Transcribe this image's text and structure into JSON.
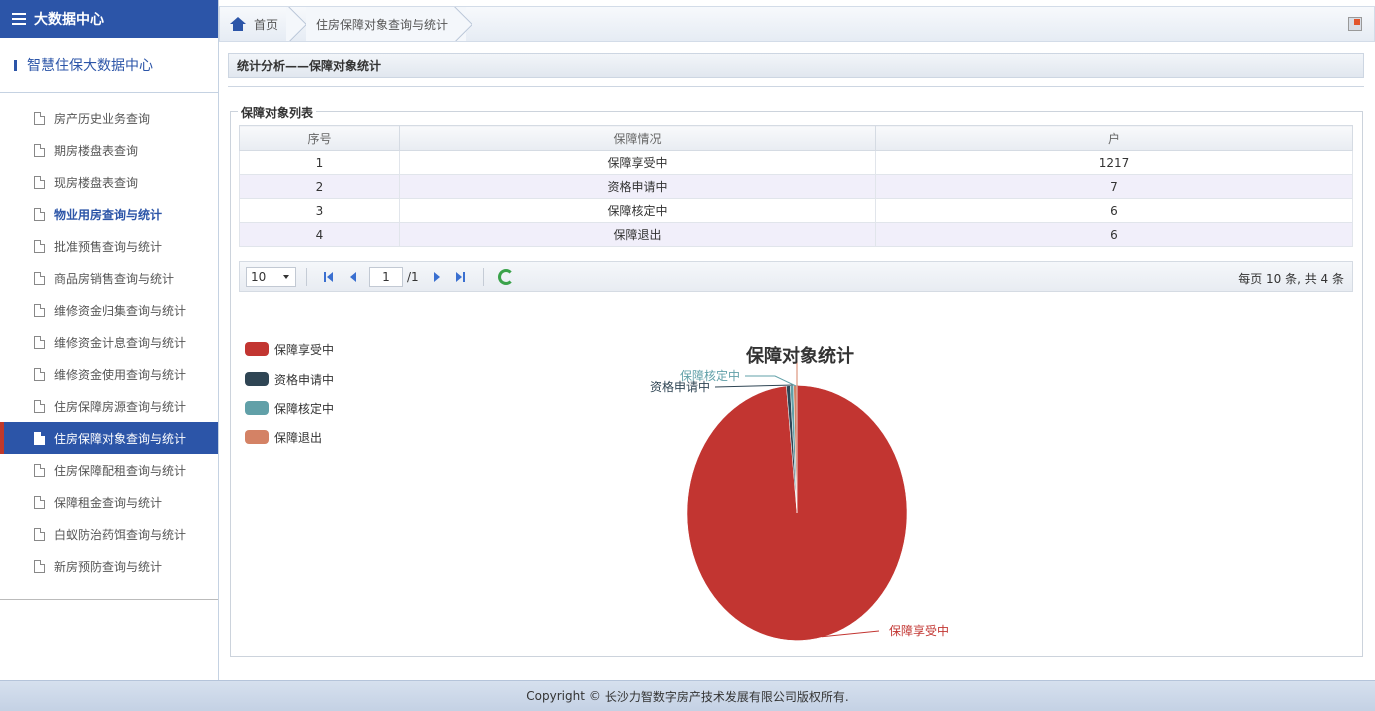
{
  "sidebar": {
    "brand": "大数据中心",
    "subheader": "智慧住保大数据中心",
    "items": [
      {
        "label": "房产历史业务查询"
      },
      {
        "label": "期房楼盘表查询"
      },
      {
        "label": "现房楼盘表查询"
      },
      {
        "label": "物业用房查询与统计"
      },
      {
        "label": "批准预售查询与统计"
      },
      {
        "label": "商品房销售查询与统计"
      },
      {
        "label": "维修资金归集查询与统计"
      },
      {
        "label": "维修资金计息查询与统计"
      },
      {
        "label": "维修资金使用查询与统计"
      },
      {
        "label": "住房保障房源查询与统计"
      },
      {
        "label": "住房保障对象查询与统计"
      },
      {
        "label": "住房保障配租查询与统计"
      },
      {
        "label": "保障租金查询与统计"
      },
      {
        "label": "白蚁防治药饵查询与统计"
      },
      {
        "label": "新房预防查询与统计"
      }
    ]
  },
  "breadcrumb": {
    "home": "首页",
    "page": "住房保障对象查询与统计"
  },
  "section": {
    "title": "统计分析——保障对象统计",
    "list_legend": "保障对象列表"
  },
  "table": {
    "headers": [
      "序号",
      "保障情况",
      "户"
    ],
    "rows": [
      [
        "1",
        "保障享受中",
        "1217"
      ],
      [
        "2",
        "资格申请中",
        "7"
      ],
      [
        "3",
        "保障核定中",
        "6"
      ],
      [
        "4",
        "保障退出",
        "6"
      ]
    ]
  },
  "pager": {
    "page_size": "10",
    "current_page": "1",
    "total_pages": "/1",
    "summary": "每页 10 条, 共 4 条"
  },
  "chart_data": {
    "type": "pie",
    "title": "保障对象统计",
    "categories": [
      "保障享受中",
      "资格申请中",
      "保障核定中",
      "保障退出"
    ],
    "values": [
      1217,
      7,
      6,
      6
    ],
    "colors": [
      "#c23531",
      "#2f4554",
      "#61a0a8",
      "#d48265"
    ],
    "legend_position": "left"
  },
  "footer": {
    "prefix": "Copyright",
    "symbol": "©",
    "text": "长沙力智数字房产技术发展有限公司版权所有."
  },
  "colors": {
    "brand_blue": "#2c55a8",
    "footer_bg": "#c4d1e4"
  }
}
